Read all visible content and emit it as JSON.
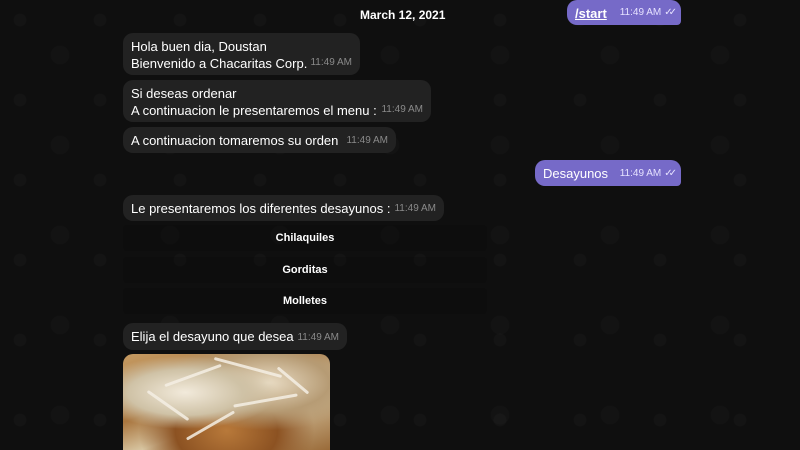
{
  "date": "March 12, 2021",
  "check_glyph": "✓✓",
  "messages": {
    "start": {
      "text": "/start",
      "time": "11:49 AM"
    },
    "greeting": {
      "line1": "Hola buen dia, Doustan",
      "line2": "Bienvenido a Chacaritas Corp.",
      "time": "11:49 AM"
    },
    "order_intro": {
      "line1": "Si deseas ordenar",
      "line2": "A continuacion le presentaremos el menu :",
      "time": "11:49 AM"
    },
    "take_order": {
      "text": "A continuacion tomaremos su orden",
      "time": "11:49 AM"
    },
    "desayunos": {
      "text": "Desayunos",
      "time": "11:49 AM"
    },
    "breakfast_list": {
      "text": "Le presentaremos los diferentes desayunos :",
      "time": "11:49 AM"
    },
    "choose": {
      "text": "Elija el desayuno que desea",
      "time": "11:49 AM"
    }
  },
  "keyboard": [
    "Chilaquiles",
    "Gorditas",
    "Molletes"
  ]
}
